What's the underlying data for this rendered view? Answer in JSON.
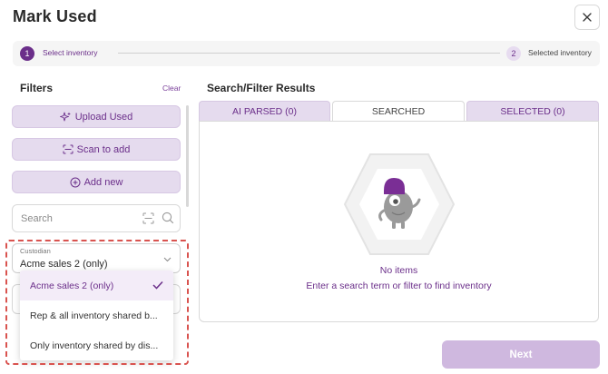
{
  "dialog": {
    "title": "Mark Used"
  },
  "stepper": {
    "steps": [
      {
        "number": "1",
        "label": "Select inventory"
      },
      {
        "number": "2",
        "label": "Selected inventory"
      }
    ]
  },
  "filters": {
    "title": "Filters",
    "clear_label": "Clear",
    "upload_label": "Upload Used",
    "scan_label": "Scan to add",
    "add_new_label": "Add new",
    "search_placeholder": "Search",
    "custodian": {
      "label": "Custodian",
      "value": "Acme sales 2 (only)",
      "options": [
        "Acme sales 2 (only)",
        "Rep & all inventory shared b...",
        "Only inventory shared by dis..."
      ]
    }
  },
  "results": {
    "title": "Search/Filter Results",
    "tabs": [
      "AI PARSED (0)",
      "SEARCHED",
      "SELECTED (0)"
    ],
    "active_tab": "SEARCHED",
    "empty_title": "No items",
    "empty_message": "Enter a search term or filter to find inventory"
  },
  "footer": {
    "next_label": "Next"
  },
  "colors": {
    "accent": "#6b2f8a",
    "accent_light": "#e5dbee",
    "next_disabled": "#cfb8df",
    "highlight": "#d9534f"
  }
}
